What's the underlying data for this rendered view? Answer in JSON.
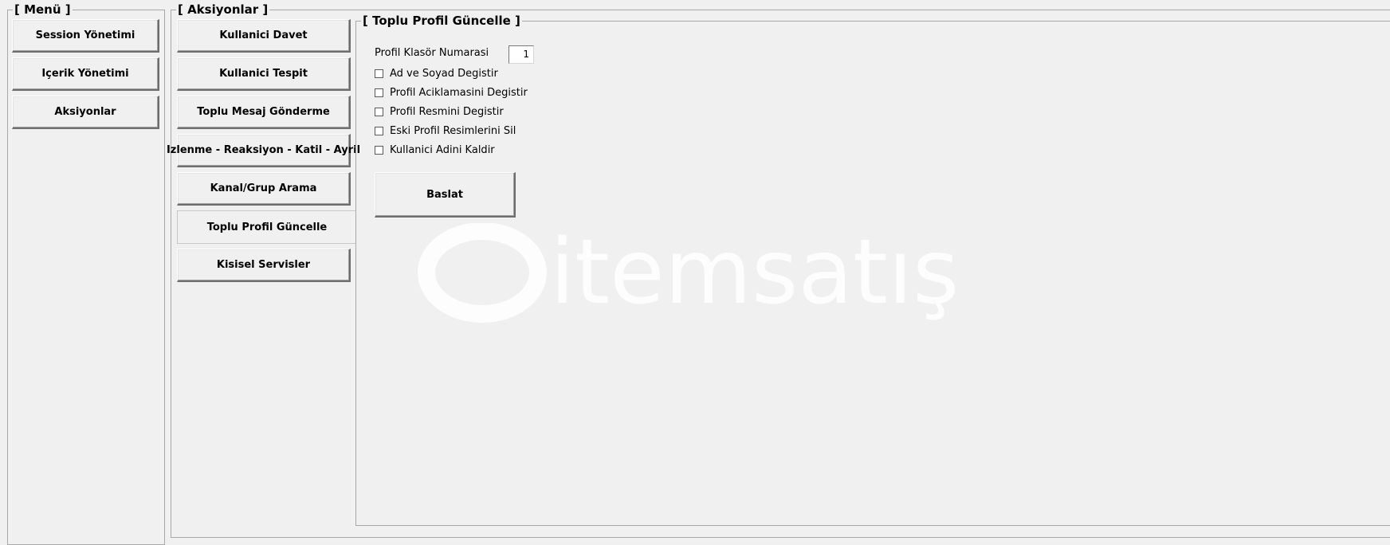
{
  "menu": {
    "title": "[ Menü ]",
    "buttons": [
      "Session Yönetimi",
      "Içerik Yönetimi",
      "Aksiyonlar"
    ]
  },
  "actions": {
    "title": "[ Aksiyonlar ]",
    "buttons": [
      "Kullanici Davet",
      "Kullanici Tespit",
      "Toplu Mesaj Gönderme",
      "Izlenme - Reaksiyon - Katil - Ayril",
      "Kanal/Grup Arama",
      "Toplu Profil Güncelle",
      "Kisisel Servisler"
    ],
    "active_index": 5
  },
  "panel": {
    "title": "[ Toplu Profil Güncelle ]",
    "folder_label": "Profil Klasör Numarasi",
    "folder_value": "1",
    "options": [
      {
        "label": "Ad ve Soyad Degistir",
        "checked": false
      },
      {
        "label": "Profil Aciklamasini Degistir",
        "checked": false
      },
      {
        "label": "Profil Resmini Degistir",
        "checked": false
      },
      {
        "label": "Eski Profil Resimlerini Sil",
        "checked": false
      },
      {
        "label": "Kullanici Adini Kaldir",
        "checked": false
      }
    ],
    "start_label": "Baslat"
  },
  "watermark": {
    "text": "itemsatış",
    "color": "#ffffff"
  }
}
